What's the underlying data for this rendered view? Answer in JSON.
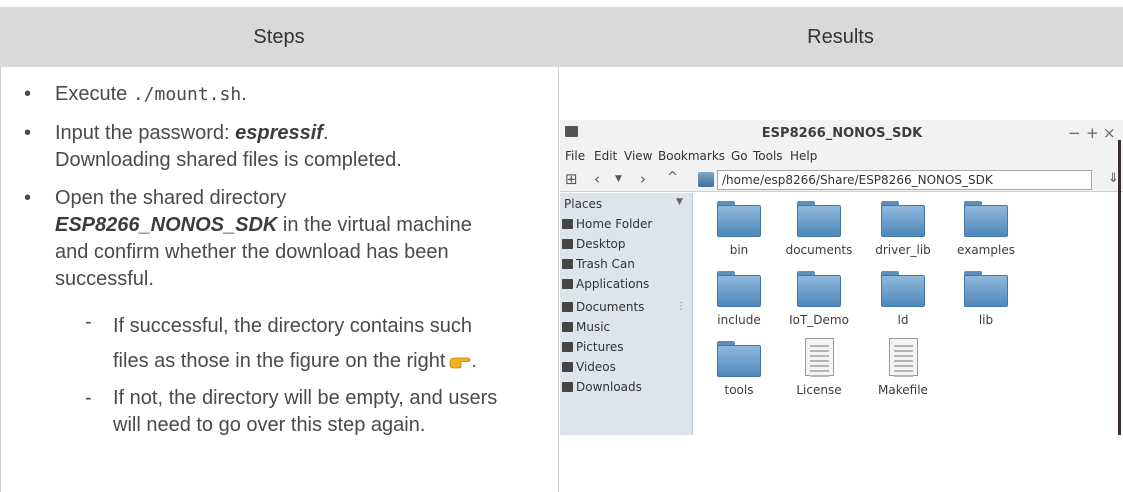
{
  "header": {
    "steps": "Steps",
    "results": "Results"
  },
  "steps": {
    "item1": {
      "prefix": "Execute ",
      "code": "./mount.sh",
      "suffix": "."
    },
    "item2": {
      "prefix": "Input the password: ",
      "password": "espressif",
      "suffix": ".",
      "line2": "Downloading shared files is completed."
    },
    "item3": {
      "line1": "Open the shared directory",
      "dir": "ESP8266_NONOS_SDK",
      "rest1": " in the virtual machine",
      "line3": "and confirm whether the download has been",
      "line4": "successful."
    },
    "sub1": {
      "line1": "If successful, the directory contains such",
      "line2": "files as those in the figure on the right",
      "suffix": "."
    },
    "sub2": {
      "line1": "If not, the directory will be empty, and users",
      "line2": "will need to go over this step again."
    }
  },
  "file_manager": {
    "title": "ESP8266_NONOS_SDK",
    "controls": {
      "minimize": "−",
      "maximize": "+",
      "close": "×"
    },
    "menu": [
      "File",
      "Edit",
      "View",
      "Bookmarks",
      "Go",
      "Tools",
      "Help"
    ],
    "path": "/home/esp8266/Share/ESP8266_NONOS_SDK",
    "places_header": "Places",
    "places": [
      "Home Folder",
      "Desktop",
      "Trash Can",
      "Applications",
      "Documents",
      "Music",
      "Pictures",
      "Videos",
      "Downloads"
    ],
    "files": [
      {
        "name": "bin",
        "type": "folder"
      },
      {
        "name": "documents",
        "type": "folder"
      },
      {
        "name": "driver_lib",
        "type": "folder"
      },
      {
        "name": "examples",
        "type": "folder"
      },
      {
        "name": "include",
        "type": "folder"
      },
      {
        "name": "IoT_Demo",
        "type": "folder"
      },
      {
        "name": "ld",
        "type": "folder"
      },
      {
        "name": "lib",
        "type": "folder"
      },
      {
        "name": "tools",
        "type": "folder"
      },
      {
        "name": "License",
        "type": "file"
      },
      {
        "name": "Makefile",
        "type": "file"
      }
    ]
  }
}
